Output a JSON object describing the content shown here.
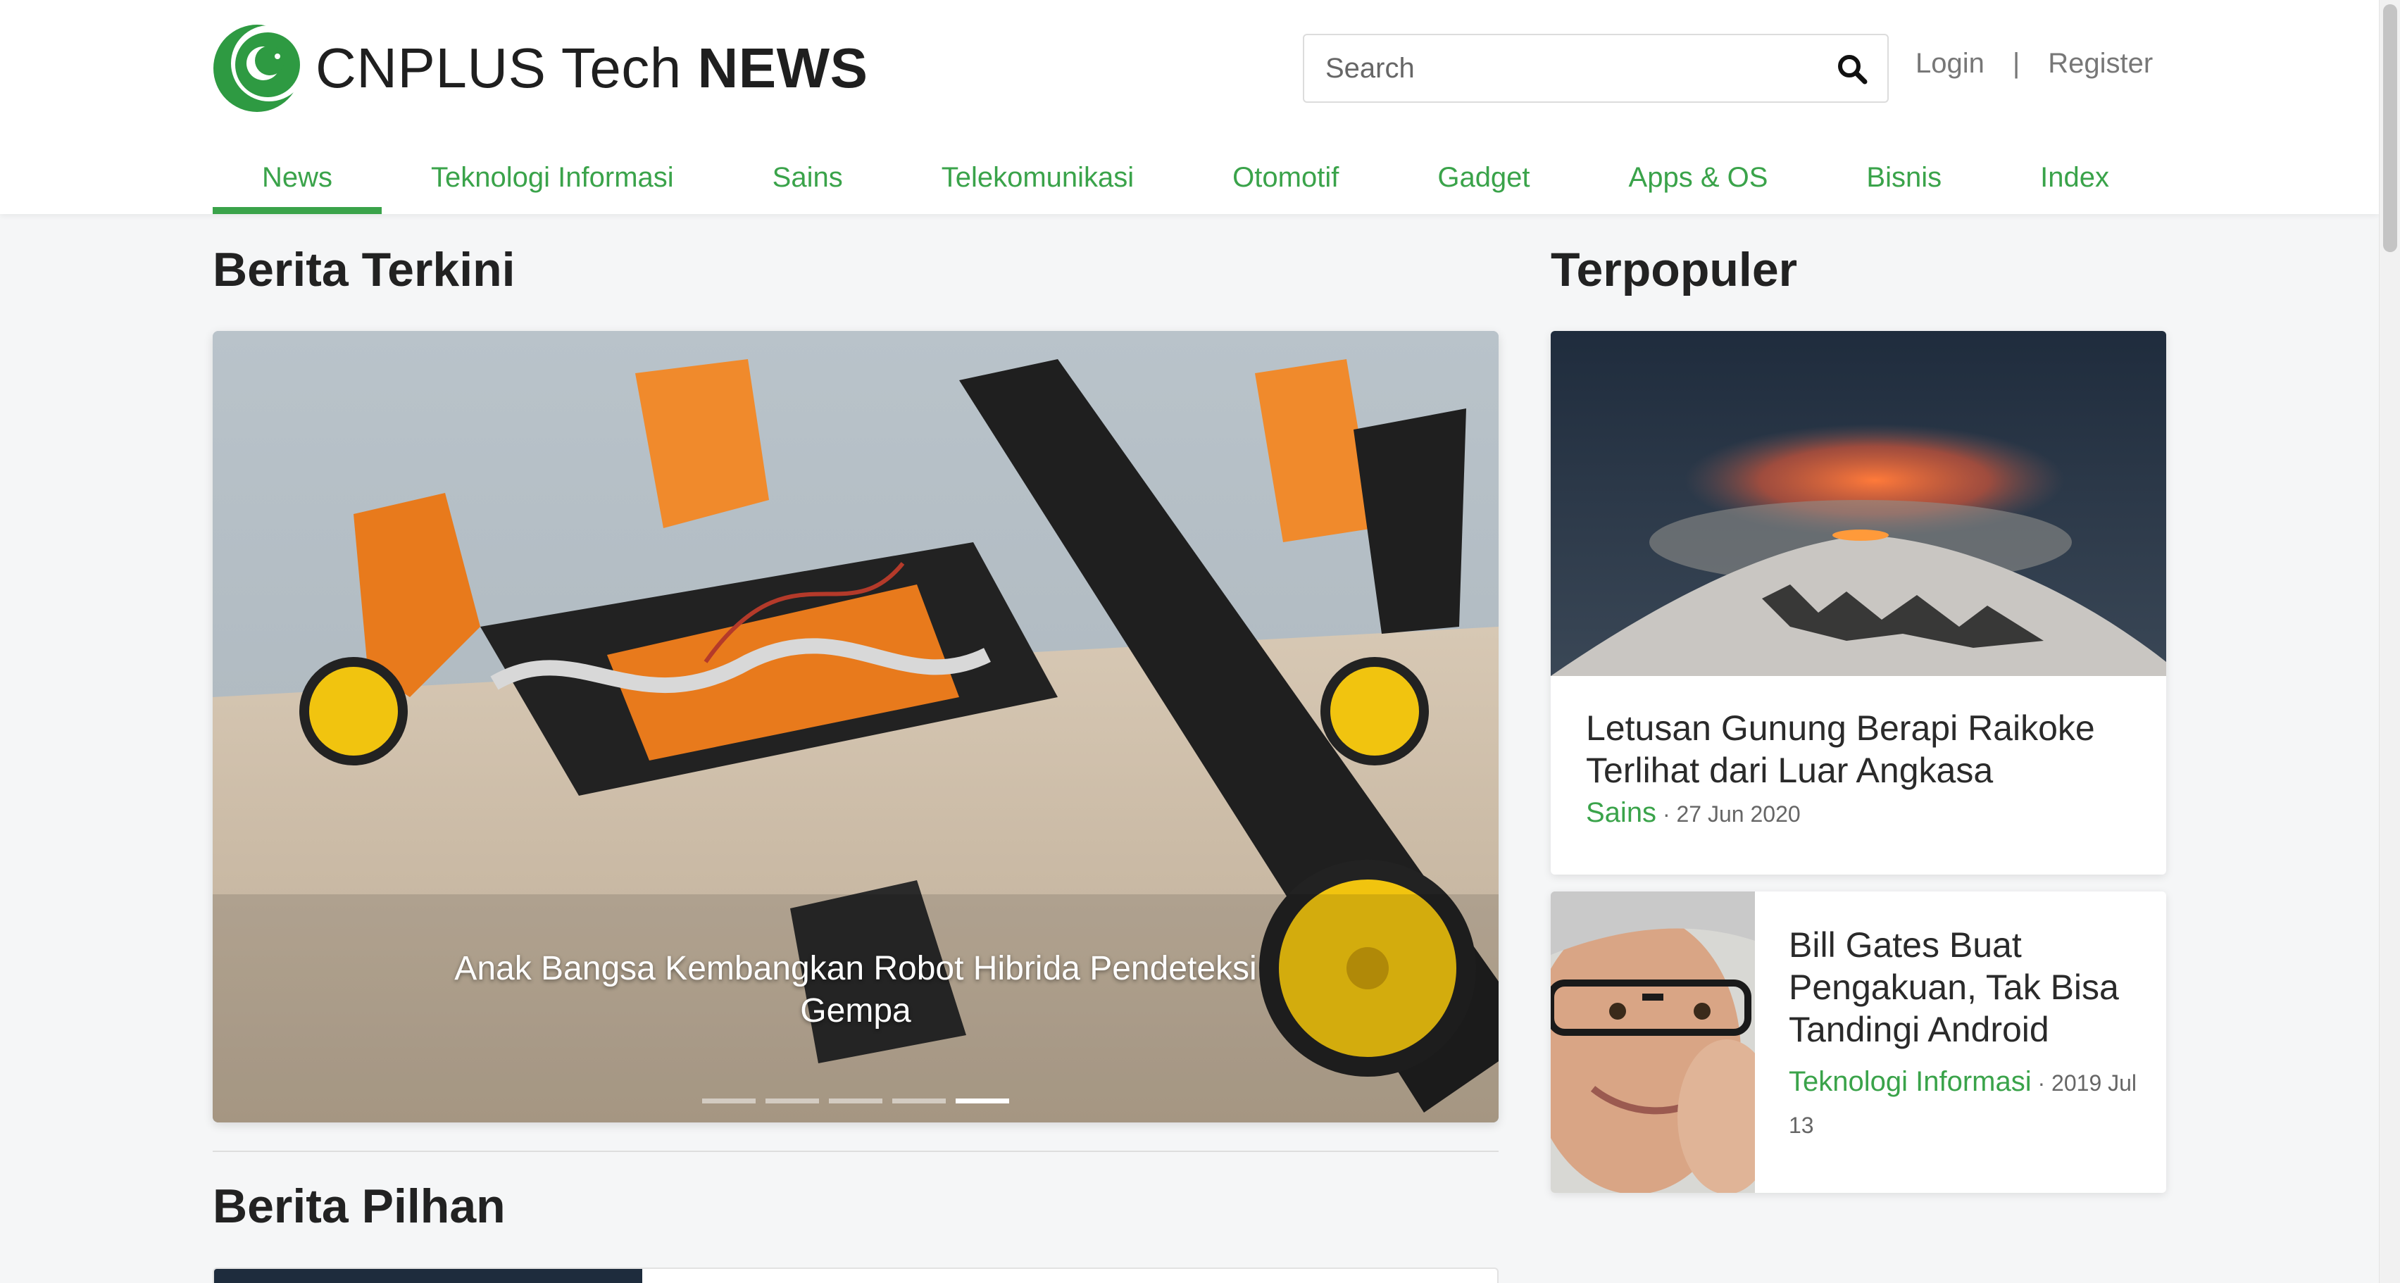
{
  "site": {
    "brand_regular": "CNPLUS Tech ",
    "brand_bold": "NEWS",
    "accent_color": "#3aa34a"
  },
  "search": {
    "placeholder": "Search",
    "icon": "search-icon"
  },
  "auth": {
    "login": "Login",
    "separator": "|",
    "register": "Register"
  },
  "nav": {
    "items": [
      {
        "label": "News",
        "active": true
      },
      {
        "label": "Teknologi Informasi"
      },
      {
        "label": "Sains"
      },
      {
        "label": "Telekomunikasi"
      },
      {
        "label": "Otomotif"
      },
      {
        "label": "Gadget"
      },
      {
        "label": "Apps & OS"
      },
      {
        "label": "Bisnis"
      },
      {
        "label": "Index"
      }
    ]
  },
  "main": {
    "latest_title": "Berita Terkini",
    "carousel": {
      "caption": "Anak Bangsa Kembangkan Robot Hibrida Pendeteksi Gempa",
      "slide_count": 5,
      "active_slide": 5
    },
    "picks_title": "Berita Pilhan"
  },
  "popular": {
    "title": "Terpopuler",
    "articles": [
      {
        "title": "Letusan Gunung Berapi Raikoke Terlihat dari Luar Angkasa",
        "category": "Sains",
        "date": "· 27 Jun 2020"
      },
      {
        "title": "Bill Gates Buat Pengakuan, Tak Bisa Tandingi Android",
        "category": "Teknologi Informasi",
        "date": "· 2019 Jul 13"
      }
    ]
  }
}
